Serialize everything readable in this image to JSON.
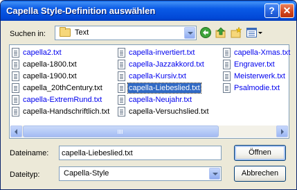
{
  "window": {
    "title": "Capella Style-Definition auswählen",
    "help_button": "?",
    "close_button": "✕"
  },
  "lookin": {
    "label": "Suchen in:",
    "value": "Text"
  },
  "toolbar": {
    "icons": [
      "back-icon",
      "up-folder-icon",
      "new-folder-icon",
      "view-menu-icon"
    ]
  },
  "files": [
    {
      "name": "capella2.txt",
      "color": "blue"
    },
    {
      "name": "capella-1800.txt",
      "color": "black"
    },
    {
      "name": "capella-1900.txt",
      "color": "black"
    },
    {
      "name": "capella_20thCentury.txt",
      "color": "black"
    },
    {
      "name": "capella-ExtremRund.txt",
      "color": "blue"
    },
    {
      "name": "capella-Handschriftlich.txt",
      "color": "black"
    },
    {
      "name": "capella-invertiert.txt",
      "color": "blue"
    },
    {
      "name": "capella-Jazzakkord.txt",
      "color": "blue"
    },
    {
      "name": "capella-Kursiv.txt",
      "color": "blue"
    },
    {
      "name": "capella-Liebeslied.txt",
      "color": "selected"
    },
    {
      "name": "capella-Neujahr.txt",
      "color": "blue"
    },
    {
      "name": "capella-Versuchslied.txt",
      "color": "black"
    },
    {
      "name": "capella-Xmas.txt",
      "color": "blue"
    },
    {
      "name": "Engraver.txt",
      "color": "blue"
    },
    {
      "name": "Meisterwerk.txt",
      "color": "blue"
    },
    {
      "name": "Psalmodie.txt",
      "color": "blue"
    }
  ],
  "filename": {
    "label": "Dateiname:",
    "value": "capella-Liebeslied.txt"
  },
  "filetype": {
    "label": "Dateityp:",
    "value": "Capella-Style"
  },
  "buttons": {
    "open": "Öffnen",
    "cancel": "Abbrechen"
  }
}
